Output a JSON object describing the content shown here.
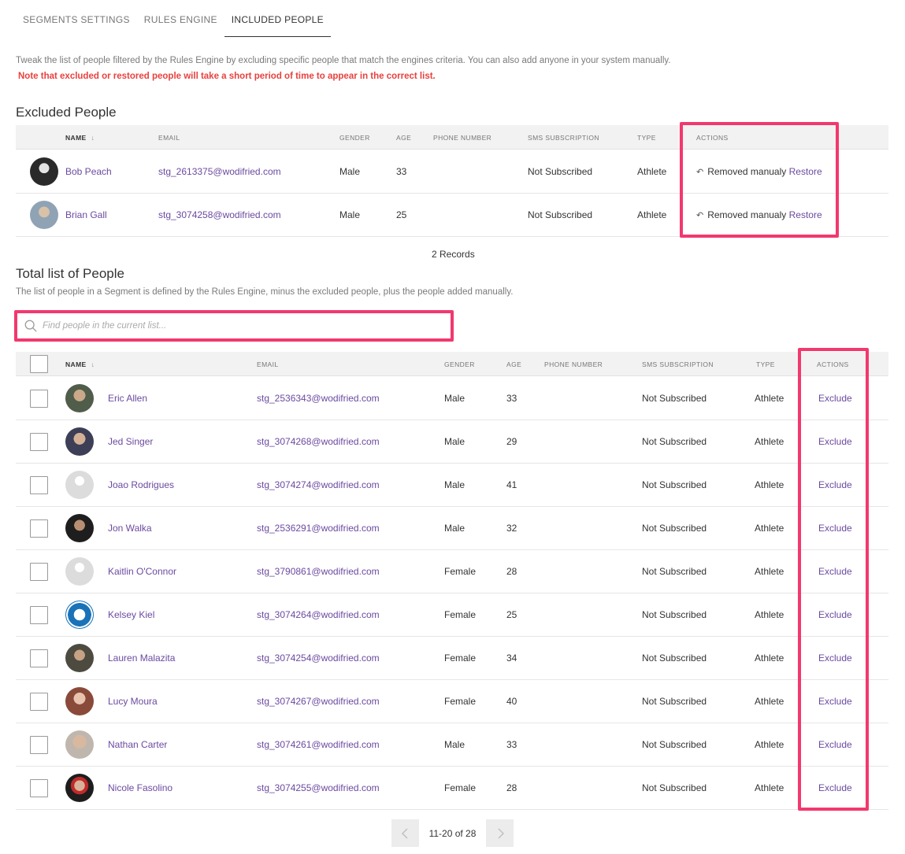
{
  "tabs": [
    {
      "label": "SEGMENTS SETTINGS"
    },
    {
      "label": "RULES ENGINE"
    },
    {
      "label": "INCLUDED PEOPLE"
    }
  ],
  "description": "Tweak the list of people filtered by the Rules Engine by excluding specific people that match the engines criteria. You can also add anyone in your system manually.",
  "warning": "Note that excluded or restored people will take a short period of time to appear in the correct list.",
  "excluded": {
    "title": "Excluded People",
    "columns": {
      "name": "NAME",
      "email": "EMAIL",
      "gender": "GENDER",
      "age": "AGE",
      "phone": "PHONE NUMBER",
      "sms": "SMS SUBSCRIPTION",
      "type": "TYPE",
      "actions": "ACTIONS"
    },
    "rows": [
      {
        "name": "Bob Peach",
        "email": "stg_2613375@wodifried.com",
        "gender": "Male",
        "age": "33",
        "phone": "",
        "sms": "Not Subscribed",
        "type": "Athlete",
        "status": "Removed manualy",
        "action": "Restore"
      },
      {
        "name": "Brian Gall",
        "email": "stg_3074258@wodifried.com",
        "gender": "Male",
        "age": "25",
        "phone": "",
        "sms": "Not Subscribed",
        "type": "Athlete",
        "status": "Removed manualy",
        "action": "Restore"
      }
    ],
    "records": "2 Records"
  },
  "total": {
    "title": "Total list of People",
    "description": "The list of people in a Segment is defined by the Rules Engine, minus the excluded people, plus the people added manually.",
    "search_placeholder": "Find people in the current list...",
    "columns": {
      "name": "NAME",
      "email": "EMAIL",
      "gender": "GENDER",
      "age": "AGE",
      "phone": "PHONE NUMBER",
      "sms": "SMS SUBSCRIPTION",
      "type": "TYPE",
      "actions": "ACTIONS"
    },
    "rows": [
      {
        "name": "Eric Allen",
        "email": "stg_2536343@wodifried.com",
        "gender": "Male",
        "age": "33",
        "sms": "Not Subscribed",
        "type": "Athlete",
        "action": "Exclude"
      },
      {
        "name": "Jed Singer",
        "email": "stg_3074268@wodifried.com",
        "gender": "Male",
        "age": "29",
        "sms": "Not Subscribed",
        "type": "Athlete",
        "action": "Exclude"
      },
      {
        "name": "Joao Rodrigues",
        "email": "stg_3074274@wodifried.com",
        "gender": "Male",
        "age": "41",
        "sms": "Not Subscribed",
        "type": "Athlete",
        "action": "Exclude"
      },
      {
        "name": "Jon Walka",
        "email": "stg_2536291@wodifried.com",
        "gender": "Male",
        "age": "32",
        "sms": "Not Subscribed",
        "type": "Athlete",
        "action": "Exclude"
      },
      {
        "name": "Kaitlin O'Connor",
        "email": "stg_3790861@wodifried.com",
        "gender": "Female",
        "age": "28",
        "sms": "Not Subscribed",
        "type": "Athlete",
        "action": "Exclude"
      },
      {
        "name": "Kelsey Kiel",
        "email": "stg_3074264@wodifried.com",
        "gender": "Female",
        "age": "25",
        "sms": "Not Subscribed",
        "type": "Athlete",
        "action": "Exclude"
      },
      {
        "name": "Lauren Malazita",
        "email": "stg_3074254@wodifried.com",
        "gender": "Female",
        "age": "34",
        "sms": "Not Subscribed",
        "type": "Athlete",
        "action": "Exclude"
      },
      {
        "name": "Lucy Moura",
        "email": "stg_3074267@wodifried.com",
        "gender": "Female",
        "age": "40",
        "sms": "Not Subscribed",
        "type": "Athlete",
        "action": "Exclude"
      },
      {
        "name": "Nathan Carter",
        "email": "stg_3074261@wodifried.com",
        "gender": "Male",
        "age": "33",
        "sms": "Not Subscribed",
        "type": "Athlete",
        "action": "Exclude"
      },
      {
        "name": "Nicole Fasolino",
        "email": "stg_3074255@wodifried.com",
        "gender": "Female",
        "age": "28",
        "sms": "Not Subscribed",
        "type": "Athlete",
        "action": "Exclude"
      }
    ]
  },
  "pagination": {
    "label": "11-20 of 28"
  },
  "colors": {
    "accent": "#6b4aa0",
    "warning": "#e8413e",
    "highlight": "#f2386e"
  }
}
